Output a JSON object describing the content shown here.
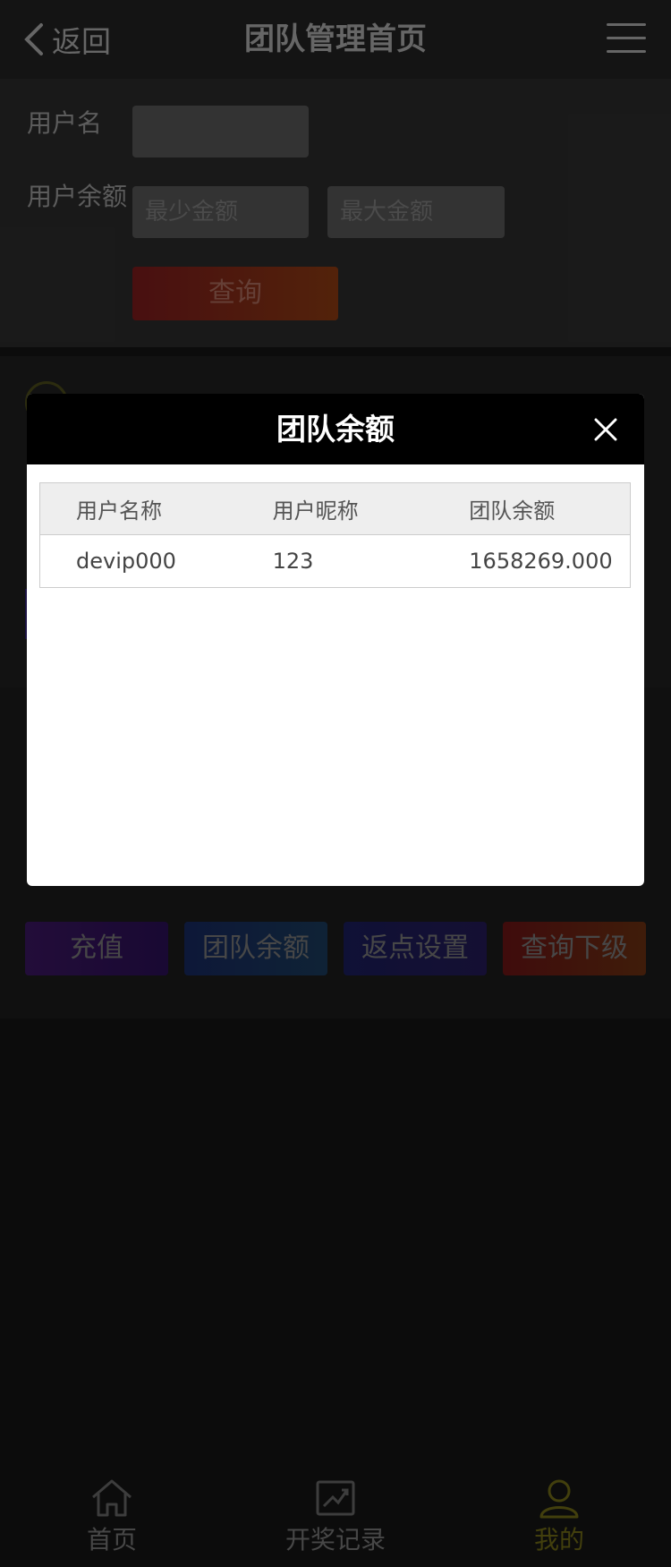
{
  "header": {
    "back_label": "返回",
    "title": "团队管理首页",
    "menu_icon": "hamburger-menu-icon"
  },
  "filter": {
    "username_label": "用户名",
    "username_value": "",
    "balance_label": "用户余额",
    "min_placeholder": "最少金额",
    "max_placeholder": "最大金额",
    "query_label": "查询"
  },
  "actions": {
    "recharge": "充值",
    "team_balance": "团队余额",
    "rebate_settings": "返点设置",
    "query_subordinates": "查询下级"
  },
  "tabbar": {
    "home": "首页",
    "lottery_records": "开奖记录",
    "mine": "我的",
    "active_tab": "mine"
  },
  "modal": {
    "title": "团队余额",
    "columns": [
      "用户名称",
      "用户昵称",
      "团队余额"
    ],
    "rows": [
      [
        "devip000",
        "123",
        "1658269.000"
      ]
    ]
  },
  "colors": {
    "header_bg": "#222222",
    "page_bg": "#141414",
    "modal_header_bg": "#000000",
    "active_tab": "#6e6a16"
  }
}
